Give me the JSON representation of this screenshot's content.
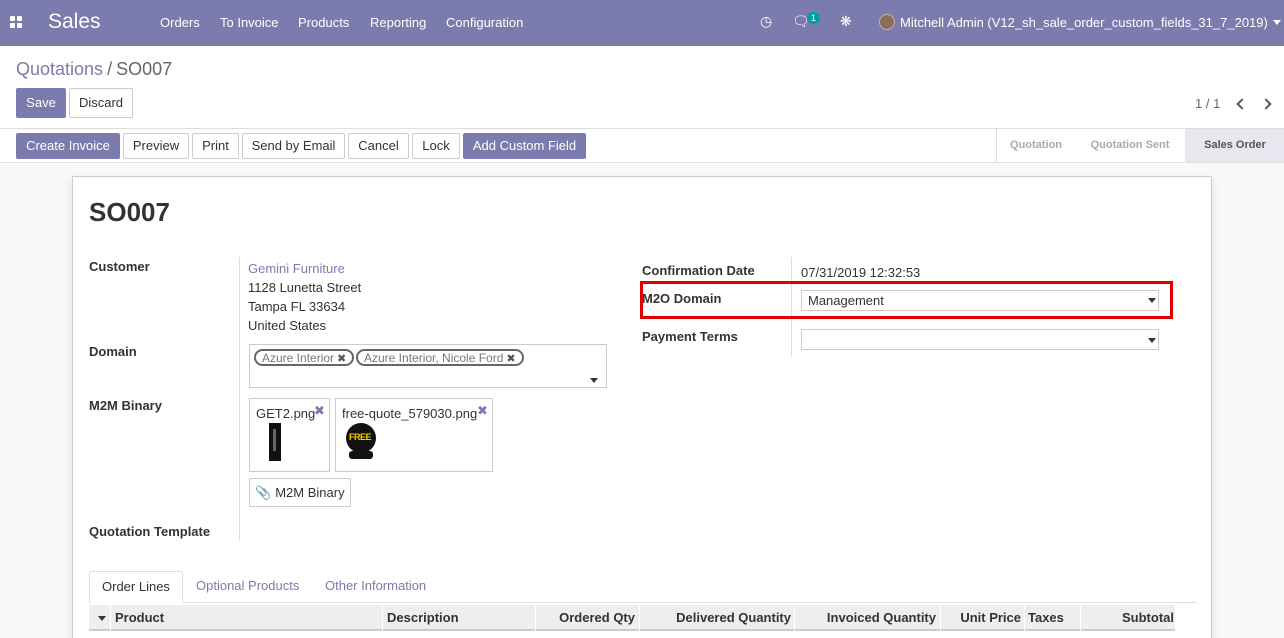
{
  "navbar": {
    "app_title": "Sales",
    "menu": [
      "Orders",
      "To Invoice",
      "Products",
      "Reporting",
      "Configuration"
    ],
    "chat_badge": "1",
    "user": "Mitchell Admin (V12_sh_sale_order_custom_fields_31_7_2019)"
  },
  "breadcrumb": {
    "parent": "Quotations",
    "separator": "/",
    "current": "SO007"
  },
  "buttons": {
    "save": "Save",
    "discard": "Discard"
  },
  "pager": "1 / 1",
  "actions": [
    "Create Invoice",
    "Preview",
    "Print",
    "Send by Email",
    "Cancel",
    "Lock",
    "Add Custom Field"
  ],
  "stages": {
    "quotation": "Quotation",
    "sent": "Quotation Sent",
    "sales_order": "Sales Order"
  },
  "form": {
    "title": "SO007",
    "customer_label": "Customer",
    "customer_name": "Gemini Furniture",
    "address": [
      "1128 Lunetta Street",
      "Tampa FL 33634",
      "United States"
    ],
    "domain_label": "Domain",
    "domain_tags": [
      "Azure Interior",
      "Azure Interior, Nicole Ford"
    ],
    "m2m_label": "M2M Binary",
    "files": [
      "GET2.png",
      "free-quote_579030.png"
    ],
    "m2m_button": "M2M Binary",
    "template_label": "Quotation Template",
    "confirmation_label": "Confirmation Date",
    "confirmation_value": "07/31/2019 12:32:53",
    "m2o_label": "M2O Domain",
    "m2o_value": "Management",
    "payment_label": "Payment Terms",
    "payment_value": ""
  },
  "tabs": [
    "Order Lines",
    "Optional Products",
    "Other Information"
  ],
  "table_headers": [
    "Product",
    "Description",
    "Ordered Qty",
    "Delivered Quantity",
    "Invoiced Quantity",
    "Unit Price",
    "Taxes",
    "Subtotal"
  ],
  "thumb_text": "FREE",
  "colors": {
    "brand": "#7c7bad",
    "highlight": "#e00000",
    "teal_badge": "#00a09d"
  }
}
